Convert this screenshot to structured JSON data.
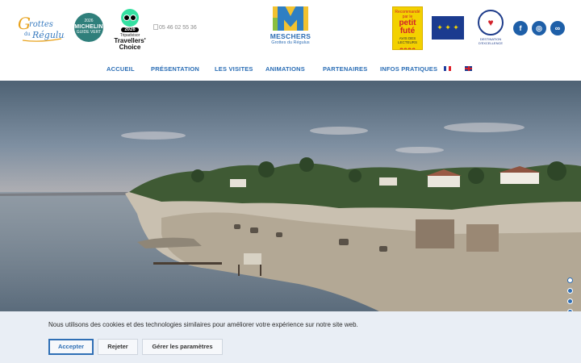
{
  "header": {
    "grottes_logo_text": "Grottes du Régulus",
    "michelin": {
      "year": "2026",
      "brand": "MICHELIN",
      "sub": "GUIDE VERT"
    },
    "tripadvisor": {
      "year": "2026",
      "brand": "Tripadvisor",
      "choice": "Travellers' Choice"
    },
    "phone": "05 46 02 55 36",
    "main_logo": {
      "title": "MESCHERS",
      "subtitle": "Grottes du Régulus"
    },
    "petit_fute": {
      "top": "Recommandé par le",
      "name": "petit futé",
      "mid": "AVIS DES LECTEURS",
      "year": "2026"
    },
    "destination": {
      "caption": "DESTINATION D'EXCELLENCE"
    },
    "social": [
      {
        "name": "facebook",
        "glyph": "f"
      },
      {
        "name": "instagram",
        "glyph": "◎"
      },
      {
        "name": "tripadvisor",
        "glyph": "∞"
      }
    ]
  },
  "nav": {
    "items": [
      "ACCUEIL",
      "PRÉSENTATION",
      "LES VISITES",
      "ANIMATIONS",
      "PARTENAIRES",
      "INFOS PRATIQUES"
    ],
    "languages": [
      "fr",
      "en"
    ]
  },
  "hero": {
    "slides_count": 6,
    "active_slide": 1
  },
  "cookie": {
    "text": "Nous utilisons des cookies et des technologies similaires pour améliorer votre expérience sur notre site web.",
    "accept": "Accepter",
    "reject": "Rejeter",
    "settings": "Gérer les paramètres"
  },
  "colors": {
    "brand_blue": "#2f6fb5",
    "brand_yellow": "#f2c230",
    "brand_green": "#8bbf3f",
    "cookie_bg": "#e9eef5"
  }
}
